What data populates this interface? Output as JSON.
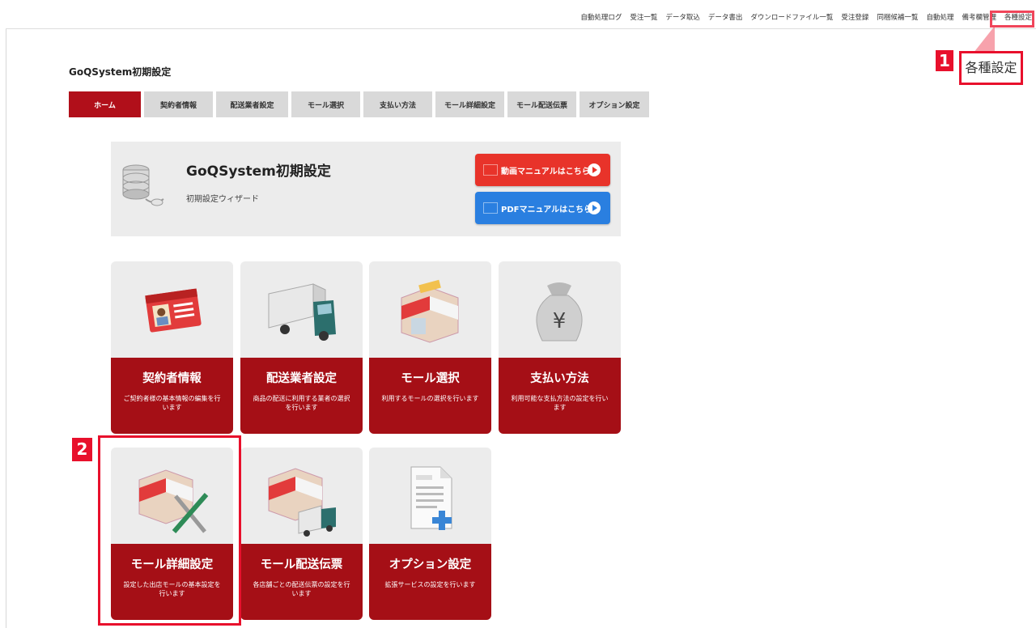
{
  "top_nav": [
    {
      "label": "自動処理ログ"
    },
    {
      "label": "受注一覧"
    },
    {
      "label": "データ取込"
    },
    {
      "label": "データ書出"
    },
    {
      "label": "ダウンロードファイル一覧"
    },
    {
      "label": "受注登録"
    },
    {
      "label": "同梱候補一覧"
    },
    {
      "label": "自動処理"
    },
    {
      "label": "備考欄管理"
    },
    {
      "label": "各種設定",
      "active": true
    }
  ],
  "callout_1": {
    "number": "1",
    "label": "各種設定"
  },
  "callout_2": {
    "number": "2"
  },
  "page_title": "GoQSystem初期設定",
  "tabs": [
    {
      "label": "ホーム",
      "active": true
    },
    {
      "label": "契約者情報"
    },
    {
      "label": "配送業者設定"
    },
    {
      "label": "モール選択"
    },
    {
      "label": "支払い方法"
    },
    {
      "label": "モール詳細設定"
    },
    {
      "label": "モール配送伝票"
    },
    {
      "label": "オプション設定"
    }
  ],
  "header": {
    "title": "GoQSystem初期設定",
    "subtitle": "初期設定ウィザード",
    "video_manual_button": "動画マニュアルはこちら",
    "pdf_manual_button": "PDFマニュアルはこちら",
    "icon": "database-icon"
  },
  "cards": [
    {
      "title": "契約者情報",
      "desc": "ご契約者様の基本情報の編集を行います",
      "icon": "id-card-icon"
    },
    {
      "title": "配送業者設定",
      "desc": "商品の配送に利用する業者の選択を行います",
      "icon": "truck-icon"
    },
    {
      "title": "モール選択",
      "desc": "利用するモールの選択を行います",
      "icon": "shop-icon"
    },
    {
      "title": "支払い方法",
      "desc": "利用可能な支払方法の設定を行います",
      "icon": "yen-bag-icon"
    },
    {
      "title": "モール詳細設定",
      "desc": "設定した出店モールの基本設定を行います",
      "icon": "shop-tools-icon"
    },
    {
      "title": "モール配送伝票",
      "desc": "各店舗ごとの配送伝票の設定を行います",
      "icon": "shop-truck-icon"
    },
    {
      "title": "オプション設定",
      "desc": "拡張サービスの設定を行います",
      "icon": "text-doc-plus-icon"
    }
  ],
  "colors": {
    "accent": "#b10f1a",
    "card_footer": "#a50f16",
    "callout": "#e8102c",
    "video_button": "#e8332a",
    "pdf_button": "#2a7fe0"
  }
}
